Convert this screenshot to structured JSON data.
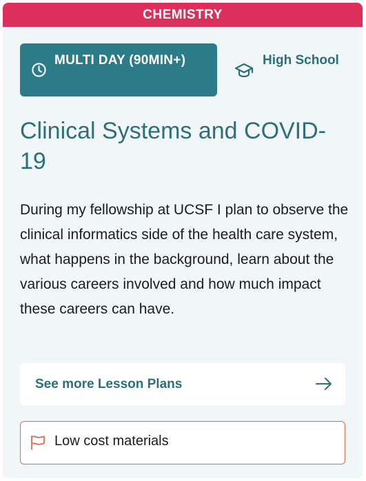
{
  "subject": "CHEMISTRY",
  "duration": {
    "label": "MULTI DAY (90MIN+)",
    "icon": "clock-icon"
  },
  "grade": {
    "label": "High School",
    "icon": "graduation-cap-icon"
  },
  "title": "Clinical Systems and COVID-19",
  "description": "During my fellowship at UCSF I plan to observe the clinical informatics side of the health care system, what happens in the background, learn about the various careers involved and how much impact these careers can have.",
  "more_link": {
    "label": "See more Lesson Plans",
    "icon": "arrow-right-icon"
  },
  "cost_tag": {
    "label": "Low cost materials",
    "icon": "flag-icon"
  },
  "colors": {
    "subject_bar": "#dc2f5c",
    "teal_badge": "#2b7b88",
    "teal_text": "#2d6f7a",
    "card_background": "#f1f6f9",
    "cost_border": "#dd6b54"
  }
}
